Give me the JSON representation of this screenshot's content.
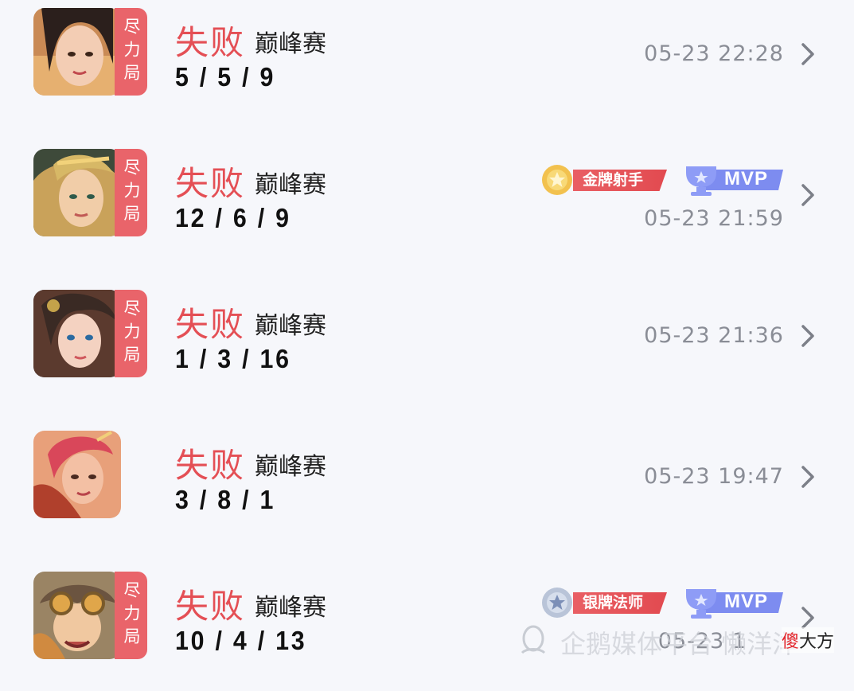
{
  "matches": [
    {
      "tag": "尽力局",
      "result": "失败",
      "mode": "巅峰赛",
      "kda": "5 / 5 / 9",
      "time": "05-23 22:28",
      "badges": [],
      "mvp": ""
    },
    {
      "tag": "尽力局",
      "result": "失败",
      "mode": "巅峰赛",
      "kda": "12 / 6 / 9",
      "time": "05-23 21:59",
      "badges": [
        "金牌射手"
      ],
      "mvp": "MVP"
    },
    {
      "tag": "尽力局",
      "result": "失败",
      "mode": "巅峰赛",
      "kda": "1 / 3 / 16",
      "time": "05-23 21:36",
      "badges": [],
      "mvp": ""
    },
    {
      "tag": "",
      "result": "失败",
      "mode": "巅峰赛",
      "kda": "3 / 8 / 1",
      "time": "05-23 19:47",
      "badges": [],
      "mvp": ""
    },
    {
      "tag": "尽力局",
      "result": "失败",
      "mode": "巅峰赛",
      "kda": "10 / 4 / 13",
      "time": "05-23 1",
      "badges": [
        "银牌法师"
      ],
      "mvp": "MVP"
    }
  ],
  "watermark": "企鹅媒体平台 懒洋洋",
  "brand": {
    "highlight": "傻",
    "rest": "大方"
  },
  "colors": {
    "loss": "#e44f55",
    "tag": "#e9646a",
    "gold_badge": "#e95f64",
    "mvp": "#7d8cf0"
  }
}
